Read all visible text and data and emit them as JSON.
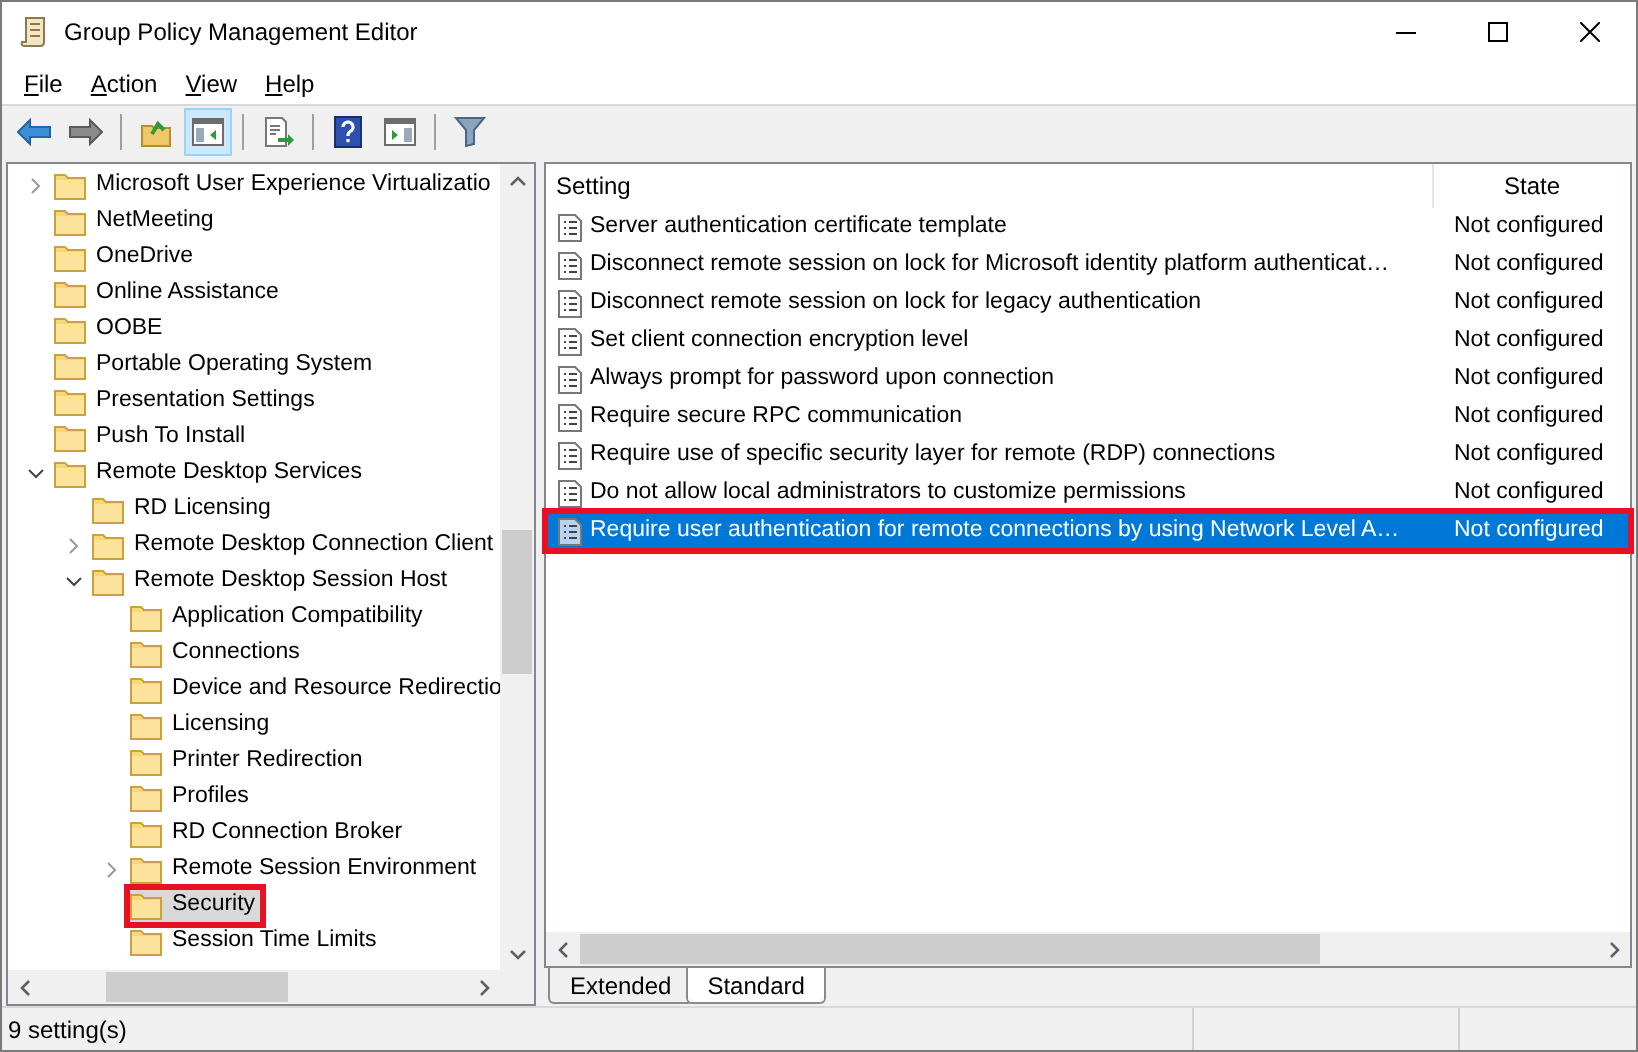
{
  "window": {
    "title": "Group Policy Management Editor"
  },
  "menu": [
    "File",
    "Action",
    "View",
    "Help"
  ],
  "toolbar": [
    {
      "kind": "back",
      "pressed": false
    },
    {
      "kind": "forward",
      "pressed": false
    },
    {
      "kind": "separator"
    },
    {
      "kind": "up",
      "pressed": false
    },
    {
      "kind": "tree",
      "pressed": true
    },
    {
      "kind": "separator"
    },
    {
      "kind": "export",
      "pressed": false
    },
    {
      "kind": "separator"
    },
    {
      "kind": "help",
      "pressed": false
    },
    {
      "kind": "pane",
      "pressed": false
    },
    {
      "kind": "separator"
    },
    {
      "kind": "filter",
      "pressed": false
    }
  ],
  "tree": [
    {
      "label": "Microsoft User Experience Virtualizatio",
      "expandable": true,
      "expanded": false,
      "selected": false,
      "highlighted": false
    },
    {
      "label": "NetMeeting",
      "expandable": false,
      "expanded": false,
      "selected": false,
      "highlighted": false
    },
    {
      "label": "OneDrive",
      "expandable": false,
      "expanded": false,
      "selected": false,
      "highlighted": false
    },
    {
      "label": "Online Assistance",
      "expandable": false,
      "expanded": false,
      "selected": false,
      "highlighted": false
    },
    {
      "label": "OOBE",
      "expandable": false,
      "expanded": false,
      "selected": false,
      "highlighted": false
    },
    {
      "label": "Portable Operating System",
      "expandable": false,
      "expanded": false,
      "selected": false,
      "highlighted": false
    },
    {
      "label": "Presentation Settings",
      "expandable": false,
      "expanded": false,
      "selected": false,
      "highlighted": false
    },
    {
      "label": "Push To Install",
      "expandable": false,
      "expanded": false,
      "selected": false,
      "highlighted": false
    },
    {
      "label": "Remote Desktop Services",
      "expandable": true,
      "expanded": true,
      "selected": false,
      "highlighted": false,
      "children": [
        {
          "label": "RD Licensing",
          "expandable": false,
          "expanded": false,
          "selected": false,
          "highlighted": false
        },
        {
          "label": "Remote Desktop Connection Client",
          "expandable": true,
          "expanded": false,
          "selected": false,
          "highlighted": false
        },
        {
          "label": "Remote Desktop Session Host",
          "expandable": true,
          "expanded": true,
          "selected": false,
          "highlighted": false,
          "children": [
            {
              "label": "Application Compatibility",
              "expandable": false,
              "expanded": false,
              "selected": false,
              "highlighted": false
            },
            {
              "label": "Connections",
              "expandable": false,
              "expanded": false,
              "selected": false,
              "highlighted": false
            },
            {
              "label": "Device and Resource Redirectio",
              "expandable": false,
              "expanded": false,
              "selected": false,
              "highlighted": false
            },
            {
              "label": "Licensing",
              "expandable": false,
              "expanded": false,
              "selected": false,
              "highlighted": false
            },
            {
              "label": "Printer Redirection",
              "expandable": false,
              "expanded": false,
              "selected": false,
              "highlighted": false
            },
            {
              "label": "Profiles",
              "expandable": false,
              "expanded": false,
              "selected": false,
              "highlighted": false
            },
            {
              "label": "RD Connection Broker",
              "expandable": false,
              "expanded": false,
              "selected": false,
              "highlighted": false
            },
            {
              "label": "Remote Session Environment",
              "expandable": true,
              "expanded": false,
              "selected": false,
              "highlighted": false
            },
            {
              "label": "Security",
              "expandable": false,
              "expanded": false,
              "selected": true,
              "highlighted": true
            },
            {
              "label": "Session Time Limits",
              "expandable": false,
              "expanded": false,
              "selected": false,
              "highlighted": false
            }
          ]
        }
      ]
    }
  ],
  "table": {
    "columns": [
      "Setting",
      "State"
    ],
    "rows": [
      {
        "setting": "Server authentication certificate template",
        "state": "Not configured",
        "selected": false,
        "highlighted": false
      },
      {
        "setting": "Disconnect remote session on lock for Microsoft identity platform authenticat…",
        "state": "Not configured",
        "selected": false,
        "highlighted": false
      },
      {
        "setting": "Disconnect remote session on lock for legacy authentication",
        "state": "Not configured",
        "selected": false,
        "highlighted": false
      },
      {
        "setting": "Set client connection encryption level",
        "state": "Not configured",
        "selected": false,
        "highlighted": false
      },
      {
        "setting": "Always prompt for password upon connection",
        "state": "Not configured",
        "selected": false,
        "highlighted": false
      },
      {
        "setting": "Require secure RPC communication",
        "state": "Not configured",
        "selected": false,
        "highlighted": false
      },
      {
        "setting": "Require use of specific security layer for remote (RDP) connections",
        "state": "Not configured",
        "selected": false,
        "highlighted": false
      },
      {
        "setting": "Do not allow local administrators to customize permissions",
        "state": "Not configured",
        "selected": false,
        "highlighted": false
      },
      {
        "setting": "Require user authentication for remote connections by using Network Level A…",
        "state": "Not configured",
        "selected": true,
        "highlighted": true
      }
    ]
  },
  "tabs": [
    {
      "label": "Extended",
      "selected": false
    },
    {
      "label": "Standard",
      "selected": true
    }
  ],
  "status_bar": "9 setting(s)"
}
